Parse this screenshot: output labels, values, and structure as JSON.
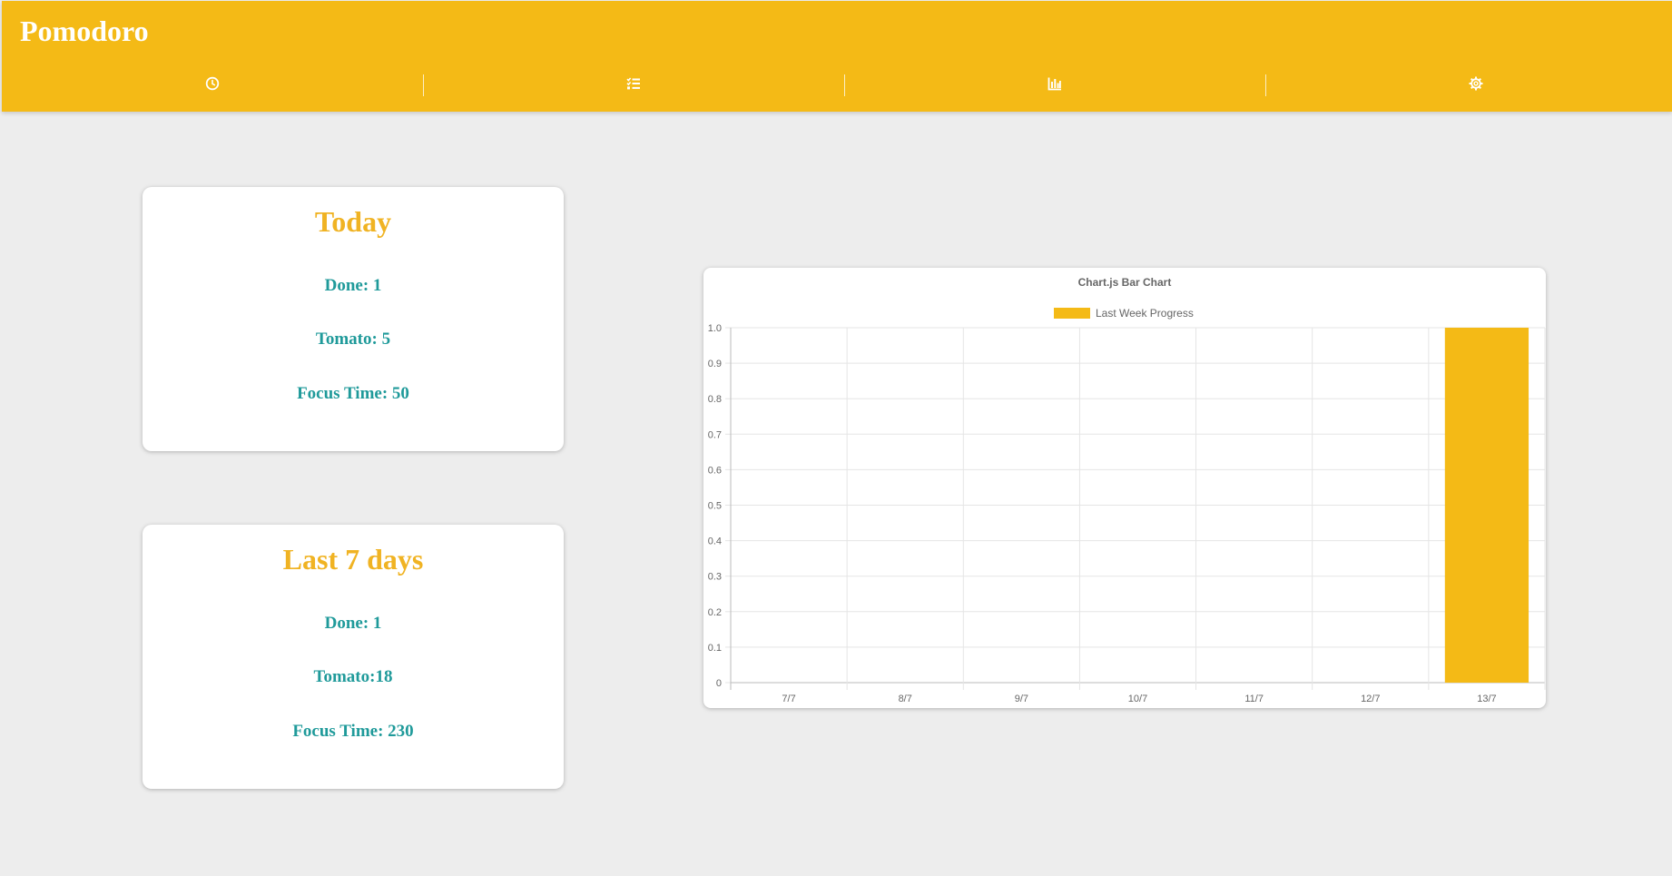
{
  "app": {
    "title": "Pomodoro"
  },
  "nav": [
    {
      "icon": "clock-icon"
    },
    {
      "icon": "task-list-icon"
    },
    {
      "icon": "bar-chart-icon"
    },
    {
      "icon": "gear-icon"
    }
  ],
  "today": {
    "title": "Today",
    "done": "Done: 1",
    "tomato": "Tomato: 5",
    "focus": "Focus Time: 50"
  },
  "week": {
    "title": "Last 7 days",
    "done": "Done: 1",
    "tomato": "Tomato:18",
    "focus": "Focus Time: 230"
  },
  "colors": {
    "accent": "#f4ba16",
    "title_text": "#f0b323",
    "stat_text": "#1f9a9a",
    "background": "#ededed"
  },
  "chart_data": {
    "type": "bar",
    "title": "Chart.js Bar Chart",
    "categories": [
      "7/7",
      "8/7",
      "9/7",
      "10/7",
      "11/7",
      "12/7",
      "13/7"
    ],
    "series": [
      {
        "name": "Last Week Progress",
        "values": [
          0,
          0,
          0,
          0,
          0,
          0,
          1
        ],
        "color": "#f4ba16"
      }
    ],
    "ylim": [
      0,
      1
    ],
    "yticks": [
      "0",
      "0.1",
      "0.2",
      "0.3",
      "0.4",
      "0.5",
      "0.6",
      "0.7",
      "0.8",
      "0.9",
      "1.0"
    ],
    "legend_position": "top",
    "grid": true
  }
}
